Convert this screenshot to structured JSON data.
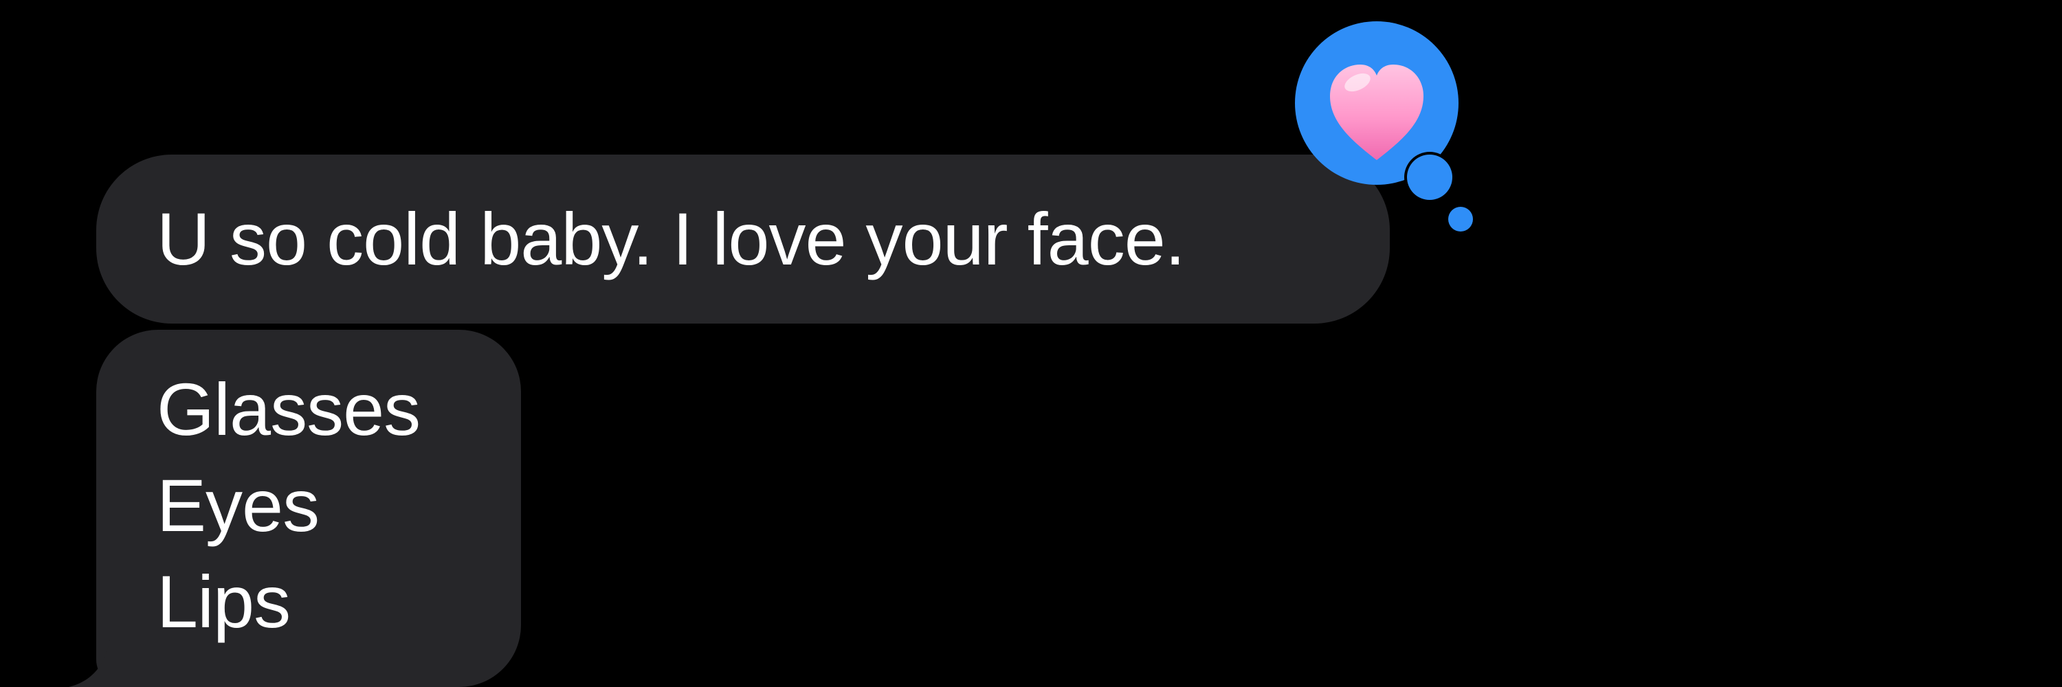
{
  "conversation": {
    "messages": [
      {
        "text": "U so cold baby. I love your face."
      },
      {
        "lines": [
          "Glasses",
          "Eyes",
          "Lips"
        ]
      }
    ]
  },
  "tapback": {
    "icon": "heart-icon",
    "bubble_color": "#2F8EF7",
    "heart_color": "#FF8FC6"
  },
  "colors": {
    "background": "#000000",
    "received_bubble": "#262629",
    "text": "#FFFFFF"
  }
}
